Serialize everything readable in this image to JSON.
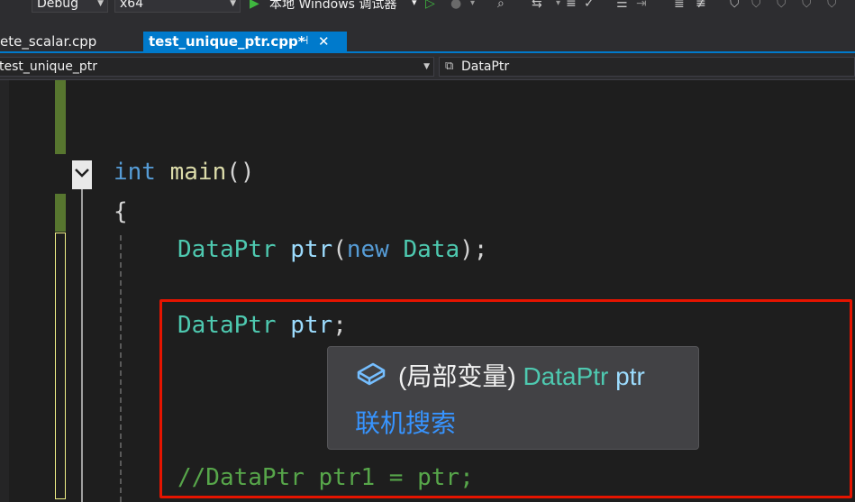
{
  "toolbar": {
    "config_value": "Debug",
    "platform_value": "x64",
    "debugger_label": "本地 Windows 调试器",
    "debugger_dropdown": "▾"
  },
  "tabs": [
    {
      "label": "ete_scalar.cpp",
      "active": false
    },
    {
      "label": "test_unique_ptr.cpp*",
      "active": true,
      "pin": "⊣",
      "close": "✕"
    }
  ],
  "navbar": {
    "scope": "test_unique_ptr",
    "member": "DataPtr"
  },
  "code": {
    "l1": {
      "kw": "int",
      "fn": "main",
      "pn": "()"
    },
    "l2": {
      "pn": "{"
    },
    "l3": {
      "ty1": "DataPtr",
      "var": "ptr",
      "p1": "(",
      "kw": "new",
      "ty2": "Data",
      "p2": ");"
    },
    "l4": {
      "ty": "DataPtr",
      "var": "ptr",
      "pn": ";"
    },
    "l5": {
      "cm": "//DataPtr ptr1 = ptr;"
    }
  },
  "tooltip": {
    "prefix": "(局部变量)",
    "type": "DataPtr",
    "name": "ptr",
    "link": "联机搜索",
    "icon": "local-variable-icon"
  },
  "colors": {
    "accent": "#007acc",
    "highlight_border": "#e51400",
    "keyword": "#569cd6",
    "type": "#4ec9b0",
    "comment": "#57a64a"
  }
}
